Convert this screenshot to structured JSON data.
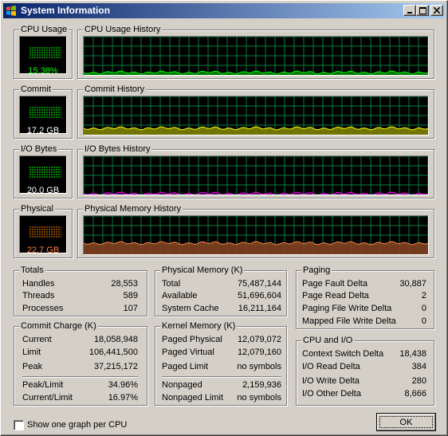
{
  "window": {
    "title": "System Information"
  },
  "meters": [
    {
      "label": "CPU Usage",
      "value": "15.38%",
      "color": "#00ff00",
      "bar_color": "#008000"
    },
    {
      "label": "Commit",
      "value": "17.2 GB",
      "color": "#ffffff",
      "bar_color": "#008000"
    },
    {
      "label": "I/O Bytes",
      "value": "20.0  GB",
      "color": "#ffffff",
      "bar_color": "#008000"
    },
    {
      "label": "Physical",
      "value": "22.7 GB",
      "color": "#ff8040",
      "bar_color": "#804000"
    }
  ],
  "graphs": [
    {
      "label": "CPU Usage History",
      "line_color": "#00ff00",
      "fill_color": "#008000",
      "level": 0.07
    },
    {
      "label": "Commit History",
      "line_color": "#ffff00",
      "fill_color": "#808000",
      "level": 0.16
    },
    {
      "label": "I/O Bytes History",
      "line_color": "#ff00ff",
      "fill_color": "#400040",
      "level": 0.03
    },
    {
      "label": "Physical Memory History",
      "line_color": "#ff8040",
      "fill_color": "#804020",
      "level": 0.3
    }
  ],
  "totals": {
    "title": "Totals",
    "rows": [
      {
        "k": "Handles",
        "v": "28,553"
      },
      {
        "k": "Threads",
        "v": "589"
      },
      {
        "k": "Processes",
        "v": "107"
      }
    ]
  },
  "physical_memory": {
    "title": "Physical Memory (K)",
    "rows": [
      {
        "k": "Total",
        "v": "75,487,144"
      },
      {
        "k": "Available",
        "v": "51,696,604"
      },
      {
        "k": "System Cache",
        "v": "16,211,164"
      }
    ]
  },
  "paging": {
    "title": "Paging",
    "rows": [
      {
        "k": "Page Fault Delta",
        "v": "30,887"
      },
      {
        "k": "Page Read Delta",
        "v": "2"
      },
      {
        "k": "Paging File Write Delta",
        "v": "0"
      },
      {
        "k": "Mapped File Write Delta",
        "v": "0"
      }
    ]
  },
  "commit_charge": {
    "title": "Commit Charge (K)",
    "rows": [
      {
        "k": "Current",
        "v": "18,058,948"
      },
      {
        "k": "Limit",
        "v": "106,441,500"
      },
      {
        "k": "Peak",
        "v": "37,215,172"
      },
      {
        "k": "Peak/Limit",
        "v": "34.96%"
      },
      {
        "k": "Current/Limit",
        "v": "16.97%"
      }
    ]
  },
  "kernel_memory": {
    "title": "Kernel Memory (K)",
    "rows": [
      {
        "k": "Paged Physical",
        "v": "12,079,072"
      },
      {
        "k": "Paged Virtual",
        "v": "12,079,160"
      },
      {
        "k": "Paged Limit",
        "v": "no symbols"
      },
      {
        "k": "Nonpaged",
        "v": "2,159,936"
      },
      {
        "k": "Nonpaged Limit",
        "v": "no symbols"
      }
    ]
  },
  "cpu_io": {
    "title": "CPU and I/O",
    "rows": [
      {
        "k": "Context Switch Delta",
        "v": "18,438"
      },
      {
        "k": "I/O Read Delta",
        "v": "384"
      },
      {
        "k": "I/O Write Delta",
        "v": "280"
      },
      {
        "k": "I/O Other Delta",
        "v": "8,666"
      }
    ]
  },
  "footer": {
    "checkbox_label": "Show one graph per CPU",
    "checked": false,
    "ok_label": "OK"
  }
}
